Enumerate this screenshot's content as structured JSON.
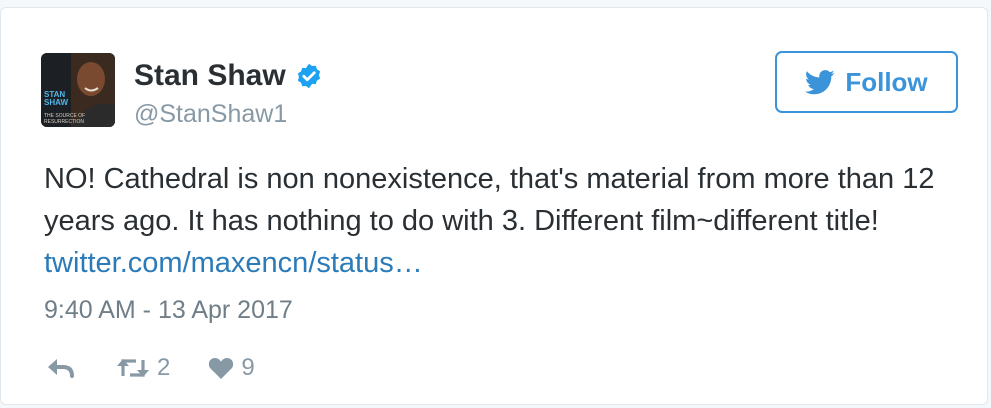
{
  "tweet": {
    "author": {
      "display_name": "Stan Shaw",
      "handle": "@StanShaw1",
      "verified": true,
      "avatar_text": [
        "STAN",
        "SHAW",
        "THE SOURCE OF",
        "RESURRECTION"
      ]
    },
    "follow_button": {
      "label": "Follow",
      "icon": "twitter-bird-icon"
    },
    "text": "NO! Cathedral is non nonexistence, that's material from more than 12 years ago. It has nothing to do with 3. Different film~different title! ",
    "link": "twitter.com/maxencn/status…",
    "timestamp": "9:40 AM - 13 Apr 2017",
    "actions": {
      "reply": {
        "icon": "reply-icon"
      },
      "retweet": {
        "icon": "retweet-icon",
        "count": "2"
      },
      "like": {
        "icon": "heart-icon",
        "count": "9"
      }
    }
  },
  "colors": {
    "accent": "#3b94d9",
    "link": "#2b7bb9",
    "text": "#292f33",
    "muted": "#8899a6",
    "verified": "#1da1f2"
  }
}
